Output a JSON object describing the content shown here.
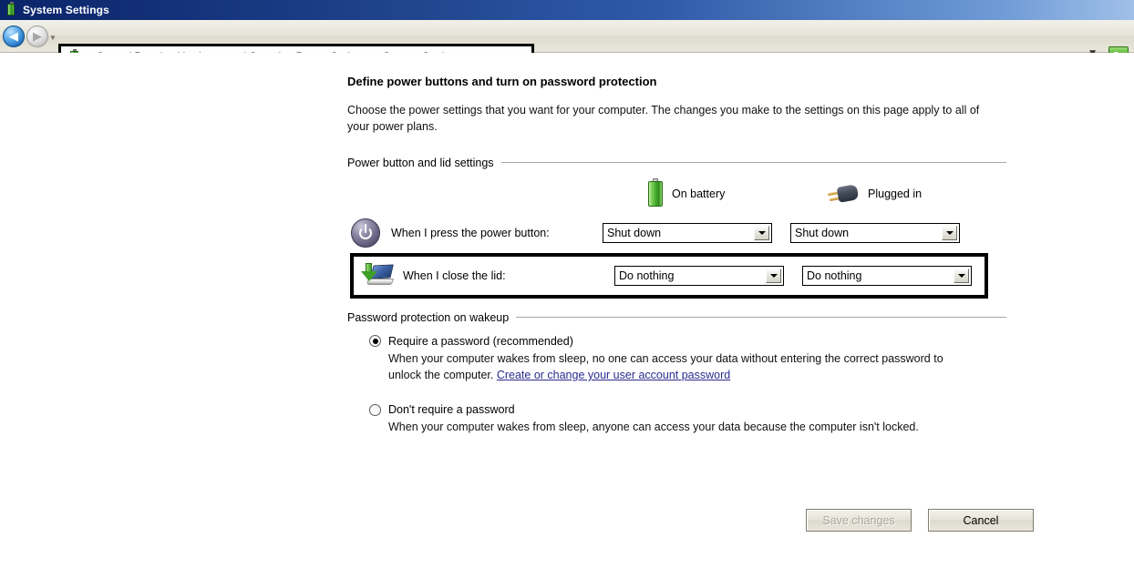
{
  "window": {
    "title": "System Settings",
    "icon": "battery-icon"
  },
  "navbar": {
    "back_icon": "back-arrow-icon",
    "forward_icon": "forward-arrow-icon",
    "recent_icon": "recent-pages-chevron-icon",
    "address_icon": "power-options-icon",
    "breadcrumbs": [
      "Control Panel",
      "Hardware and Sound",
      "Power Options",
      "System Settings"
    ],
    "separator": "▾",
    "dropdown_icon": "address-dropdown-chevron-icon",
    "refresh_icon": "refresh-icon",
    "refresh_glyph": "↻"
  },
  "main": {
    "title": "Define power buttons and turn on password protection",
    "description": "Choose the power settings that you want for your computer. The changes you make to the settings on this page apply to all of your power plans.",
    "power_group": {
      "label": "Power button and lid settings",
      "columns": [
        {
          "label": "On battery",
          "icon": "battery-icon"
        },
        {
          "label": "Plugged in",
          "icon": "power-plug-icon"
        }
      ],
      "rows": [
        {
          "label": "When I press the power button:",
          "icon": "power-button-icon",
          "on_battery_value": "Shut down",
          "plugged_in_value": "Shut down",
          "highlighted": false
        },
        {
          "label": "When I close the lid:",
          "icon": "laptop-lid-icon",
          "on_battery_value": "Do nothing",
          "plugged_in_value": "Do nothing",
          "highlighted": true
        }
      ]
    },
    "password_group": {
      "label": "Password protection on wakeup",
      "options": [
        {
          "label": "Require a password (recommended)",
          "selected": true,
          "description_before": "When your computer wakes from sleep, no one can access your data without entering the correct password to unlock the computer. ",
          "link": "Create or change your user account password",
          "description_after": ""
        },
        {
          "label": "Don't require a password",
          "selected": false,
          "description_before": "When your computer wakes from sleep, anyone can access your data because the computer isn't locked.",
          "link": "",
          "description_after": ""
        }
      ]
    },
    "footer": {
      "save_label": "Save changes",
      "save_enabled": false,
      "cancel_label": "Cancel",
      "cancel_enabled": true
    }
  },
  "colors": {
    "titlebar_start": "#0a246a",
    "titlebar_end": "#9fc0e8",
    "link": "#2b2b8f",
    "highlight_border": "#000000",
    "battery_green": "#41a82b",
    "chrome_bg": "#e6e4d8"
  }
}
